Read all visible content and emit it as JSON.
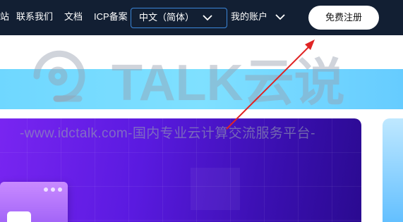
{
  "nav": {
    "links": [
      "站",
      "联系我们",
      "文档",
      "ICP备案"
    ],
    "language_select": {
      "value": "中文（简体）"
    },
    "account_label": "我的账户",
    "register_label": "免费注册"
  },
  "watermark": {
    "brand": "TALK云说",
    "tagline": "-www.idctalk.com-国内专业云计算交流服务平台-"
  },
  "colors": {
    "nav_bg": "#121f33",
    "select_border": "#3b86d9",
    "banner_cyan": "#6fd7ff",
    "hero_purple": "#7a26f2",
    "annotation_arrow": "#e02424"
  }
}
